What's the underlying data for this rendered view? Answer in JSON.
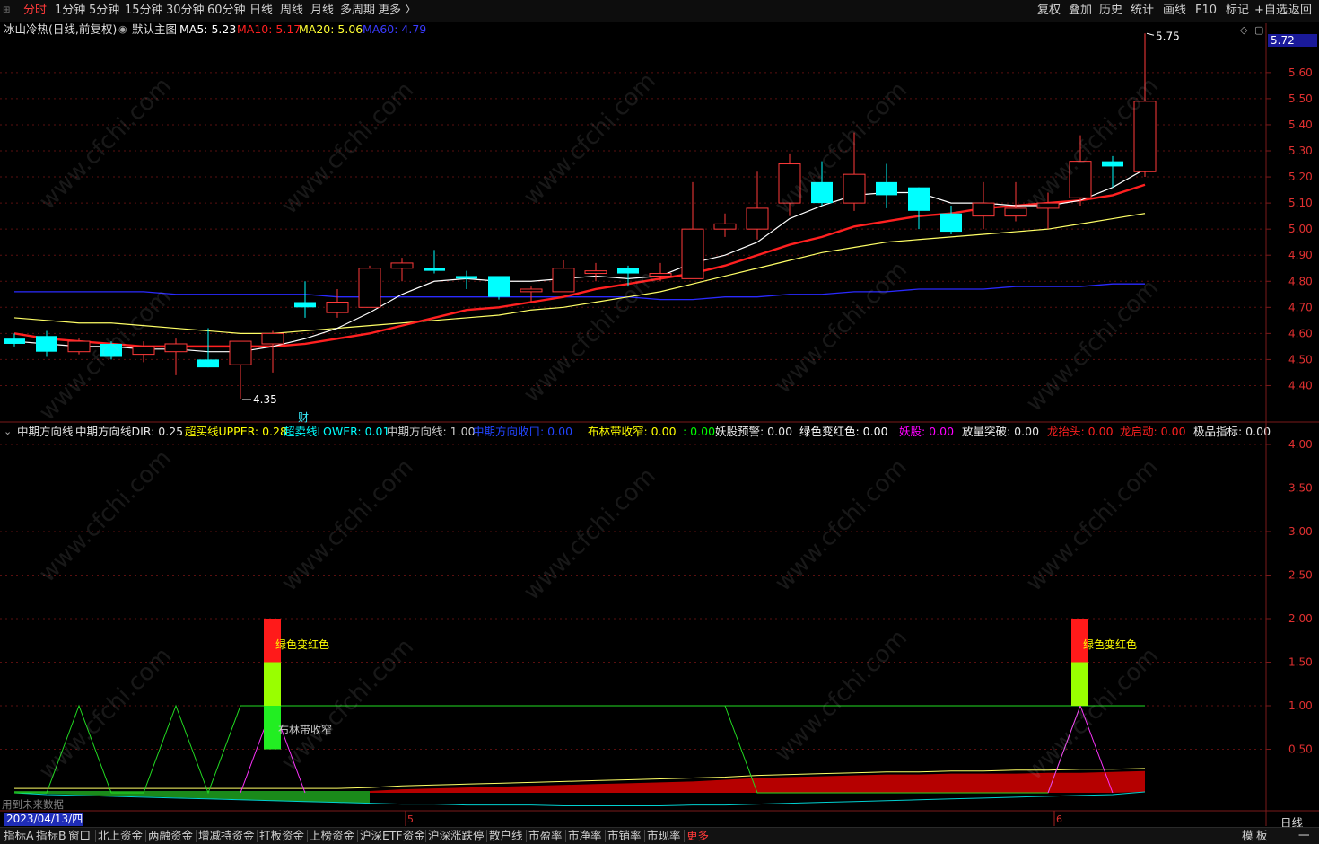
{
  "topbar": {
    "left_items": [
      "分时",
      "1分钟",
      "5分钟",
      "15分钟",
      "30分钟",
      "60分钟",
      "日线",
      "周线",
      "月线",
      "多周期",
      "更多 〉"
    ],
    "active_item": "分时",
    "right_items": [
      "复权",
      "叠加",
      "历史",
      "统计",
      "画线",
      "F10",
      "标记",
      "+自选",
      "返回"
    ]
  },
  "main_info": {
    "title": "冰山冷热(日线,前复权)",
    "template": "默认主图",
    "ma5": "MA5: 5.23",
    "ma10": "MA10: 5.17",
    "ma20": "MA20: 5.06",
    "ma60": "MA60: 4.79"
  },
  "sub_info": {
    "name": "中期方向线",
    "items": [
      {
        "text": "中期方向线DIR: 0.25",
        "color": "#e6e6e6"
      },
      {
        "text": "超买线UPPER: 0.28",
        "color": "#ffff00"
      },
      {
        "text": "超卖线LOWER: 0.01",
        "color": "#00ffff"
      },
      {
        "text": "中期方向线: 1.00",
        "color": "#cccccc"
      },
      {
        "text": "中期方向收口: 0.00",
        "color": "#2244ff"
      },
      {
        "text": "布林带收窄: 0.00",
        "color": "#ffff00"
      },
      {
        "text": ": 0.00",
        "color": "#00ff00"
      },
      {
        "text": "妖股预警: 0.00",
        "color": "#e6e6e6"
      },
      {
        "text": "绿色变红色: 0.00",
        "color": "#ffffff"
      },
      {
        "text": "妖股: 0.00",
        "color": "#ff00ff"
      },
      {
        "text": "放量突破: 0.00",
        "color": "#e6e6e6"
      },
      {
        "text": "龙抬头: 0.00",
        "color": "#ff2020"
      },
      {
        "text": "龙启动: 0.00",
        "color": "#ff2020"
      },
      {
        "text": "极品指标: 0.00",
        "color": "#e6e6e6"
      }
    ]
  },
  "price_axis": {
    "current_price": "5.72",
    "ticks": [
      "5.60",
      "5.50",
      "5.40",
      "5.30",
      "5.20",
      "5.10",
      "5.00",
      "4.90",
      "4.80",
      "4.70",
      "4.60",
      "4.50",
      "4.40"
    ]
  },
  "sub_axis": {
    "ticks": [
      "4.00",
      "3.50",
      "3.00",
      "2.50",
      "2.00",
      "1.50",
      "1.00",
      "0.50"
    ]
  },
  "annotations": {
    "high_label": "5.75",
    "low_label": "4.35",
    "cai_label": "财",
    "signal_label": "绿色变红色",
    "bollinger_label": "布林带收窄",
    "future_note": "用到未来数据"
  },
  "date_axis": {
    "selected_date": "2023/04/13/四",
    "month_labels": [
      "5",
      "6"
    ],
    "period": "日线"
  },
  "watermark": "www.cfchi.com",
  "bottombar": {
    "items": [
      "指标A",
      "指标B",
      "窗口",
      "北上资金",
      "两融资金",
      "增减持资金",
      "打板资金",
      "上榜资金",
      "沪深ETF资金",
      "沪深涨跌停",
      "散户线",
      "市盈率",
      "市净率",
      "市销率",
      "市现率",
      "更多"
    ],
    "right_items": [
      "模",
      "板",
      "一"
    ]
  },
  "colors": {
    "up": "#ff3a3a",
    "down": "#00ffff",
    "ma5": "#ffffff",
    "ma10": "#ff2020",
    "ma20": "#ffff66",
    "ma60": "#2a2aff",
    "grid": "#5a0f0f"
  },
  "chart_data": [
    {
      "type": "candlestick",
      "title": "冰山冷热(日线,前复权)",
      "ylim": [
        4.33,
        5.78
      ],
      "candles": [
        {
          "o": 4.58,
          "h": 4.6,
          "l": 4.55,
          "c": 4.56
        },
        {
          "o": 4.59,
          "h": 4.61,
          "l": 4.51,
          "c": 4.53
        },
        {
          "o": 4.53,
          "h": 4.58,
          "l": 4.52,
          "c": 4.57
        },
        {
          "o": 4.56,
          "h": 4.57,
          "l": 4.5,
          "c": 4.51
        },
        {
          "o": 4.52,
          "h": 4.57,
          "l": 4.49,
          "c": 4.55
        },
        {
          "o": 4.53,
          "h": 4.58,
          "l": 4.44,
          "c": 4.56
        },
        {
          "o": 4.5,
          "h": 4.62,
          "l": 4.47,
          "c": 4.47
        },
        {
          "o": 4.48,
          "h": 4.57,
          "l": 4.35,
          "c": 4.57
        },
        {
          "o": 4.56,
          "h": 4.61,
          "l": 4.45,
          "c": 4.6
        },
        {
          "o": 4.72,
          "h": 4.8,
          "l": 4.66,
          "c": 4.7
        },
        {
          "o": 4.68,
          "h": 4.77,
          "l": 4.66,
          "c": 4.72
        },
        {
          "o": 4.7,
          "h": 4.86,
          "l": 4.7,
          "c": 4.85
        },
        {
          "o": 4.85,
          "h": 4.89,
          "l": 4.8,
          "c": 4.87
        },
        {
          "o": 4.85,
          "h": 4.92,
          "l": 4.83,
          "c": 4.84
        },
        {
          "o": 4.82,
          "h": 4.84,
          "l": 4.77,
          "c": 4.81
        },
        {
          "o": 4.82,
          "h": 4.82,
          "l": 4.73,
          "c": 4.74
        },
        {
          "o": 4.76,
          "h": 4.78,
          "l": 4.72,
          "c": 4.77
        },
        {
          "o": 4.76,
          "h": 4.88,
          "l": 4.76,
          "c": 4.85
        },
        {
          "o": 4.83,
          "h": 4.87,
          "l": 4.8,
          "c": 4.84
        },
        {
          "o": 4.85,
          "h": 4.86,
          "l": 4.78,
          "c": 4.83
        },
        {
          "o": 4.82,
          "h": 4.87,
          "l": 4.8,
          "c": 4.83
        },
        {
          "o": 4.81,
          "h": 5.18,
          "l": 4.81,
          "c": 5.0
        },
        {
          "o": 5.0,
          "h": 5.06,
          "l": 4.97,
          "c": 5.02
        },
        {
          "o": 5.0,
          "h": 5.22,
          "l": 4.96,
          "c": 5.08
        },
        {
          "o": 5.1,
          "h": 5.29,
          "l": 5.05,
          "c": 5.25
        },
        {
          "o": 5.18,
          "h": 5.26,
          "l": 5.09,
          "c": 5.1
        },
        {
          "o": 5.1,
          "h": 5.37,
          "l": 5.07,
          "c": 5.21
        },
        {
          "o": 5.18,
          "h": 5.25,
          "l": 5.08,
          "c": 5.13
        },
        {
          "o": 5.16,
          "h": 5.16,
          "l": 5.0,
          "c": 5.07
        },
        {
          "o": 5.06,
          "h": 5.09,
          "l": 4.98,
          "c": 4.99
        },
        {
          "o": 5.05,
          "h": 5.18,
          "l": 5.0,
          "c": 5.1
        },
        {
          "o": 5.05,
          "h": 5.18,
          "l": 5.03,
          "c": 5.08
        },
        {
          "o": 5.08,
          "h": 5.14,
          "l": 5.0,
          "c": 5.1
        },
        {
          "o": 5.12,
          "h": 5.36,
          "l": 5.09,
          "c": 5.26
        },
        {
          "o": 5.26,
          "h": 5.28,
          "l": 5.16,
          "c": 5.24
        },
        {
          "o": 5.22,
          "h": 5.75,
          "l": 5.2,
          "c": 5.49
        }
      ],
      "ma5": [
        4.57,
        4.56,
        4.55,
        4.55,
        4.54,
        4.54,
        4.53,
        4.53,
        4.55,
        4.58,
        4.62,
        4.68,
        4.75,
        4.8,
        4.81,
        4.8,
        4.8,
        4.81,
        4.82,
        4.81,
        4.82,
        4.87,
        4.9,
        4.95,
        5.04,
        5.09,
        5.13,
        5.14,
        5.14,
        5.1,
        5.1,
        5.09,
        5.09,
        5.11,
        5.16,
        5.23
      ],
      "ma10": [
        4.6,
        4.58,
        4.57,
        4.56,
        4.55,
        4.55,
        4.55,
        4.55,
        4.55,
        4.56,
        4.58,
        4.6,
        4.63,
        4.66,
        4.69,
        4.7,
        4.72,
        4.74,
        4.77,
        4.79,
        4.81,
        4.83,
        4.86,
        4.9,
        4.94,
        4.97,
        5.01,
        5.03,
        5.05,
        5.06,
        5.08,
        5.09,
        5.1,
        5.11,
        5.13,
        5.17
      ],
      "ma20": [
        4.66,
        4.65,
        4.64,
        4.64,
        4.63,
        4.62,
        4.61,
        4.6,
        4.6,
        4.61,
        4.62,
        4.63,
        4.64,
        4.65,
        4.66,
        4.67,
        4.69,
        4.7,
        4.72,
        4.74,
        4.76,
        4.79,
        4.82,
        4.85,
        4.88,
        4.91,
        4.93,
        4.95,
        4.96,
        4.97,
        4.98,
        4.99,
        5.0,
        5.02,
        5.04,
        5.06
      ],
      "ma60": [
        4.76,
        4.76,
        4.76,
        4.76,
        4.76,
        4.75,
        4.75,
        4.75,
        4.75,
        4.75,
        4.74,
        4.74,
        4.74,
        4.74,
        4.74,
        4.74,
        4.74,
        4.74,
        4.74,
        4.74,
        4.73,
        4.73,
        4.74,
        4.74,
        4.75,
        4.75,
        4.76,
        4.76,
        4.77,
        4.77,
        4.77,
        4.78,
        4.78,
        4.78,
        4.79,
        4.79
      ]
    },
    {
      "type": "line",
      "title": "中期方向线",
      "ylim": [
        0,
        4.2
      ],
      "green_line_x": [
        0,
        1,
        2,
        3,
        4,
        5,
        6,
        7,
        8,
        9,
        18,
        19,
        20,
        21,
        22,
        23,
        24,
        25,
        26,
        27,
        28,
        29,
        30,
        31,
        32,
        33,
        34,
        35
      ],
      "green_line_y": [
        0,
        0,
        1,
        0,
        0,
        1,
        0,
        1,
        1,
        1,
        1,
        1,
        1,
        1,
        1,
        1,
        1,
        1,
        1,
        1,
        1,
        1,
        1,
        1,
        1,
        1,
        1,
        1
      ],
      "magenta_trigger_days": [
        8,
        33
      ],
      "signal_days": [
        8,
        33
      ],
      "dir_values": [
        0.02,
        0.02,
        0.02,
        0.02,
        0.02,
        0.02,
        0.02,
        0.02,
        0.02,
        0.02,
        0.02,
        0.02,
        0.04,
        0.05,
        0.06,
        0.07,
        0.08,
        0.09,
        0.1,
        0.11,
        0.12,
        0.13,
        0.15,
        0.17,
        0.18,
        0.19,
        0.2,
        0.21,
        0.21,
        0.22,
        0.22,
        0.22,
        0.23,
        0.23,
        0.24,
        0.25
      ],
      "upper_values": [
        0.05,
        0.05,
        0.05,
        0.05,
        0.05,
        0.05,
        0.05,
        0.05,
        0.05,
        0.05,
        0.05,
        0.06,
        0.08,
        0.09,
        0.1,
        0.11,
        0.12,
        0.13,
        0.14,
        0.15,
        0.16,
        0.17,
        0.18,
        0.2,
        0.21,
        0.22,
        0.23,
        0.24,
        0.24,
        0.25,
        0.25,
        0.26,
        0.26,
        0.27,
        0.27,
        0.28
      ],
      "lower_values": [
        0.0,
        -0.02,
        -0.03,
        -0.04,
        -0.05,
        -0.06,
        -0.07,
        -0.08,
        -0.09,
        -0.1,
        -0.11,
        -0.12,
        -0.13,
        -0.13,
        -0.14,
        -0.14,
        -0.14,
        -0.15,
        -0.15,
        -0.15,
        -0.15,
        -0.14,
        -0.14,
        -0.13,
        -0.12,
        -0.11,
        -0.1,
        -0.09,
        -0.08,
        -0.07,
        -0.06,
        -0.05,
        -0.04,
        -0.03,
        -0.02,
        0.01
      ]
    }
  ]
}
